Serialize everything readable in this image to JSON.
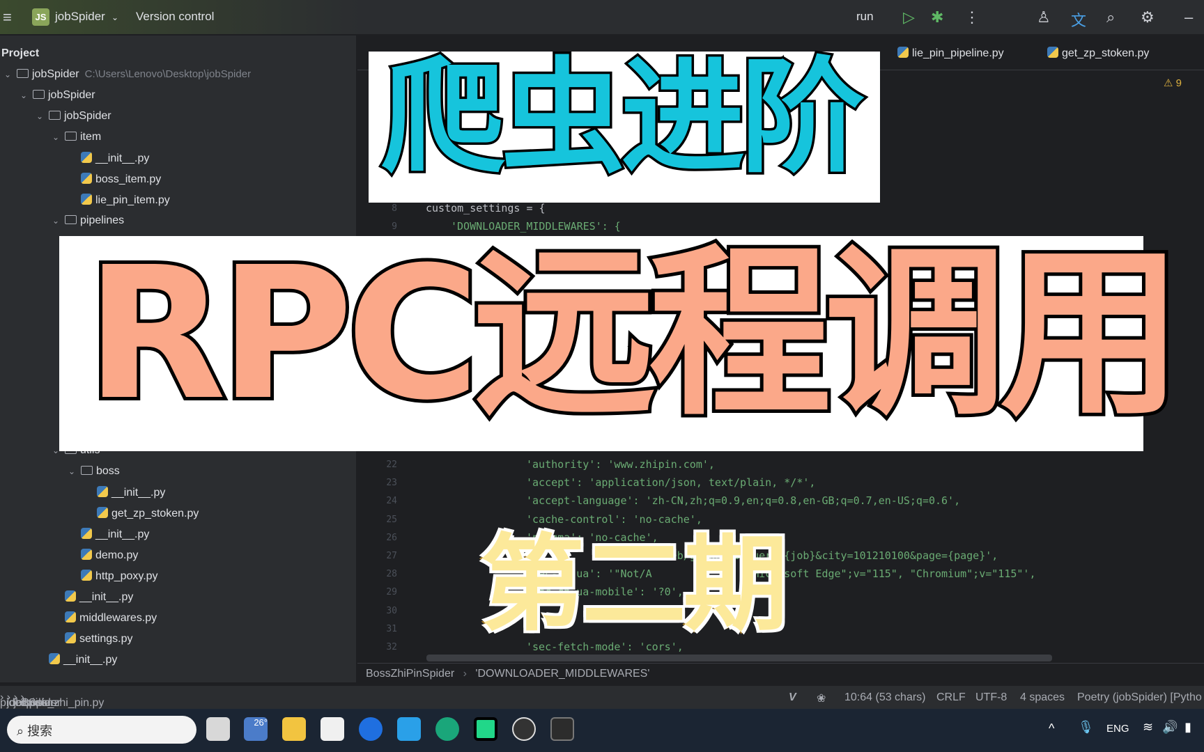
{
  "titlebar": {
    "project_badge": "JS",
    "project": "jobSpider",
    "vcs": "Version control",
    "run_config": "run"
  },
  "sidebar": {
    "header": "Project",
    "items": [
      {
        "label": "jobSpider",
        "path": "C:\\Users\\Lenovo\\Desktop\\jobSpider",
        "type": "folder",
        "depth": 0,
        "row": 0
      },
      {
        "label": "jobSpider",
        "type": "folder",
        "depth": 1,
        "row": 1
      },
      {
        "label": "jobSpider",
        "type": "folder",
        "depth": 2,
        "row": 2
      },
      {
        "label": "item",
        "type": "folder",
        "depth": 3,
        "row": 3
      },
      {
        "label": "__init__.py",
        "type": "py",
        "depth": 4,
        "row": 4
      },
      {
        "label": "boss_item.py",
        "type": "py",
        "depth": 4,
        "row": 5
      },
      {
        "label": "lie_pin_item.py",
        "type": "py",
        "depth": 4,
        "row": 6
      },
      {
        "label": "pipelines",
        "type": "folder",
        "depth": 3,
        "row": 7
      },
      {
        "label": "utils",
        "type": "folder",
        "depth": 3,
        "row": 18
      },
      {
        "label": "boss",
        "type": "folder",
        "depth": 4,
        "row": 19
      },
      {
        "label": "__init__.py",
        "type": "py",
        "depth": 5,
        "row": 20
      },
      {
        "label": "get_zp_stoken.py",
        "type": "py",
        "depth": 5,
        "row": 21
      },
      {
        "label": "__init__.py",
        "type": "py",
        "depth": 4,
        "row": 22
      },
      {
        "label": "demo.py",
        "type": "py",
        "depth": 4,
        "row": 23
      },
      {
        "label": "http_poxy.py",
        "type": "py",
        "depth": 4,
        "row": 24
      },
      {
        "label": "__init__.py",
        "type": "py",
        "depth": 3,
        "row": 25
      },
      {
        "label": "middlewares.py",
        "type": "py",
        "depth": 3,
        "row": 26
      },
      {
        "label": "settings.py",
        "type": "py",
        "depth": 3,
        "row": 27
      },
      {
        "label": "__init__.py",
        "type": "py",
        "depth": 2,
        "row": 28
      }
    ]
  },
  "tabs": [
    "lie_pin_pipeline.py",
    "get_zp_stoken.py"
  ],
  "inspection": {
    "warnings": "9"
  },
  "code": [
    {
      "ln": "8",
      "text": "custom_settings = {",
      "indent": 1,
      "plain": true
    },
    {
      "ln": "9",
      "text": "'DOWNLOADER_MIDDLEWARES': {",
      "indent": 2
    },
    {
      "ln": "22",
      "text": "'authority': 'www.zhipin.com',",
      "indent": 5
    },
    {
      "ln": "23",
      "text": "'accept': 'application/json, text/plain, */*',",
      "indent": 5
    },
    {
      "ln": "24",
      "text": "'accept-language': 'zh-CN,zh;q=0.9,en;q=0.8,en-GB;q=0.7,en-US;q=0.6',",
      "indent": 5
    },
    {
      "ln": "25",
      "text": "'cache-control': 'no-cache',",
      "indent": 5
    },
    {
      "ln": "26",
      "text": "'pragma': 'no-cache',",
      "indent": 5
    },
    {
      "ln": "27",
      "text": "                     /web/geek/job?query={job}&city=101210100&page={page}',",
      "indent": 5
    },
    {
      "ln": "28",
      "text": "'sec-ch-ua': '\"Not/A               \"Microsoft Edge\";v=\"115\", \"Chromium\";v=\"115\"',",
      "indent": 5
    },
    {
      "ln": "29",
      "text": "'sec-ch-ua-mobile': '?0',",
      "indent": 5
    },
    {
      "ln": "30",
      "text": "",
      "indent": 5
    },
    {
      "ln": "31",
      "text": "",
      "indent": 5
    },
    {
      "ln": "32",
      "text": "'sec-fetch-mode': 'cors',",
      "indent": 5
    }
  ],
  "editor_breadcrumb": [
    "BossZhiPinSpider",
    "'DOWNLOADER_MIDDLEWARES'"
  ],
  "status": {
    "path": [
      "pider",
      "jobSpider",
      "jobSpider",
      "spiders",
      "boss_zhi_pin.py"
    ],
    "position": "10:64 (53 chars)",
    "line_sep": "CRLF",
    "encoding": "UTF-8",
    "indent": "4 spaces",
    "interpreter": "Poetry (jobSpider) [Pytho"
  },
  "taskbar": {
    "search_placeholder": "搜索",
    "weather": "26°",
    "lang": "ENG"
  },
  "overlays": {
    "title_top": "爬虫进阶",
    "title_main": "RPC远程调用",
    "episode": "第二期"
  },
  "colors": {
    "accent_cyan": "#16c4dc",
    "accent_salmon": "#fba889",
    "accent_yellow": "#fce99a"
  }
}
